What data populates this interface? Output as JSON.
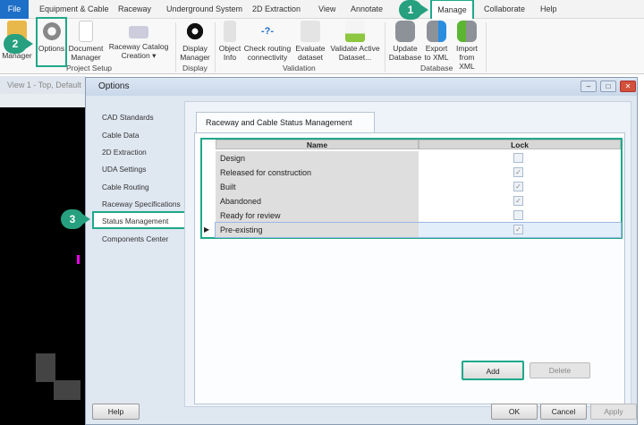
{
  "ribbon_tabs": [
    "File",
    "Equipment & Cable",
    "Raceway",
    "Underground System",
    "2D Extraction",
    "View",
    "Annotate",
    "Manage",
    "Collaborate",
    "Help"
  ],
  "ribbon": {
    "buttons": [
      "Manager",
      "Options",
      "Document Manager",
      "Raceway Catalog Creation ▾",
      "Display Manager",
      "Object Info",
      "Check routing connectivity",
      "Evaluate dataset",
      "Validate Active Dataset...",
      "Update Database",
      "Export to XML",
      "Import from XML"
    ],
    "groups": [
      "Project Setup",
      "Display",
      "Validation",
      "Database"
    ]
  },
  "callouts": [
    "1",
    "2",
    "3"
  ],
  "view": {
    "title": "View 1 - Top, Default"
  },
  "dialog": {
    "title": "Options",
    "nav": [
      "CAD Standards",
      "Cable Data",
      "2D Extraction",
      "UDA Settings",
      "Cable Routing",
      "Raceway Specifications",
      "Status Management",
      "Components Center"
    ],
    "tab": "Raceway and Cable Status Management",
    "columns": [
      "Name",
      "Lock"
    ],
    "rows": [
      {
        "name": "Design",
        "lock": false
      },
      {
        "name": "Released for construction",
        "lock": true
      },
      {
        "name": "Built",
        "lock": true
      },
      {
        "name": "Abandoned",
        "lock": true
      },
      {
        "name": "Ready for review",
        "lock": false
      },
      {
        "name": "Pre-existing",
        "lock": true
      }
    ],
    "add": "Add",
    "delete": "Delete",
    "help": "Help",
    "ok": "OK",
    "cancel": "Cancel",
    "apply": "Apply"
  }
}
